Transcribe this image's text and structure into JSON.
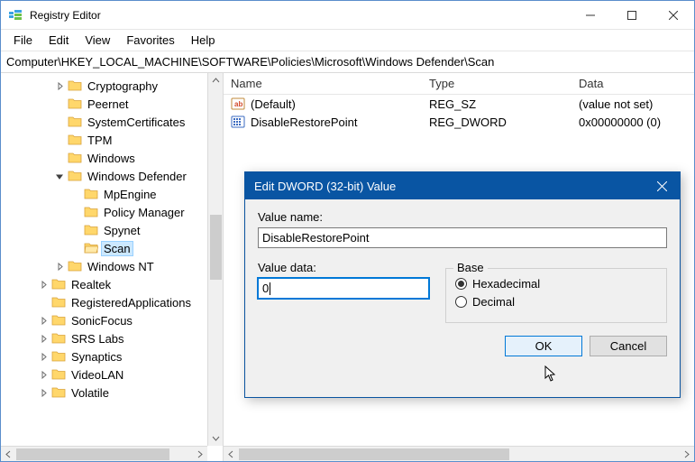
{
  "window": {
    "title": "Registry Editor",
    "minimize_tooltip": "Minimize",
    "maximize_tooltip": "Maximize",
    "close_tooltip": "Close"
  },
  "menu": {
    "file": "File",
    "edit": "Edit",
    "view": "View",
    "favorites": "Favorites",
    "help": "Help"
  },
  "address_path": "Computer\\HKEY_LOCAL_MACHINE\\SOFTWARE\\Policies\\Microsoft\\Windows Defender\\Scan",
  "tree": {
    "items": [
      {
        "indent": 3,
        "expander": "closed",
        "label": "Cryptography",
        "selected": false
      },
      {
        "indent": 3,
        "expander": "none",
        "label": "Peernet",
        "selected": false
      },
      {
        "indent": 3,
        "expander": "none",
        "label": "SystemCertificates",
        "selected": false
      },
      {
        "indent": 3,
        "expander": "none",
        "label": "TPM",
        "selected": false
      },
      {
        "indent": 3,
        "expander": "none",
        "label": "Windows",
        "selected": false
      },
      {
        "indent": 3,
        "expander": "open",
        "label": "Windows Defender",
        "selected": false
      },
      {
        "indent": 4,
        "expander": "none",
        "label": "MpEngine",
        "selected": false
      },
      {
        "indent": 4,
        "expander": "none",
        "label": "Policy Manager",
        "selected": false
      },
      {
        "indent": 4,
        "expander": "none",
        "label": "Spynet",
        "selected": false
      },
      {
        "indent": 4,
        "expander": "none",
        "label": "Scan",
        "selected": true
      },
      {
        "indent": 3,
        "expander": "closed",
        "label": "Windows NT",
        "selected": false
      },
      {
        "indent": 2,
        "expander": "closed",
        "label": "Realtek",
        "selected": false
      },
      {
        "indent": 2,
        "expander": "none",
        "label": "RegisteredApplications",
        "selected": false
      },
      {
        "indent": 2,
        "expander": "closed",
        "label": "SonicFocus",
        "selected": false
      },
      {
        "indent": 2,
        "expander": "closed",
        "label": "SRS Labs",
        "selected": false
      },
      {
        "indent": 2,
        "expander": "closed",
        "label": "Synaptics",
        "selected": false
      },
      {
        "indent": 2,
        "expander": "closed",
        "label": "VideoLAN",
        "selected": false
      },
      {
        "indent": 2,
        "expander": "closed",
        "label": "Volatile",
        "selected": false
      }
    ]
  },
  "list": {
    "columns": {
      "name": "Name",
      "type": "Type",
      "data": "Data"
    },
    "column_widths": {
      "name": 220,
      "type": 166,
      "data": 130
    },
    "rows": [
      {
        "icon": "string",
        "name": "(Default)",
        "type": "REG_SZ",
        "data": "(value not set)"
      },
      {
        "icon": "dword",
        "name": "DisableRestorePoint",
        "type": "REG_DWORD",
        "data": "0x00000000 (0)"
      }
    ]
  },
  "dialog": {
    "title": "Edit DWORD (32-bit) Value",
    "value_name_label": "Value name:",
    "value_name": "DisableRestorePoint",
    "value_data_label": "Value data:",
    "value_data": "0",
    "base_label": "Base",
    "radio_hex": "Hexadecimal",
    "radio_dec": "Decimal",
    "selected_base": "hex",
    "ok": "OK",
    "cancel": "Cancel"
  }
}
